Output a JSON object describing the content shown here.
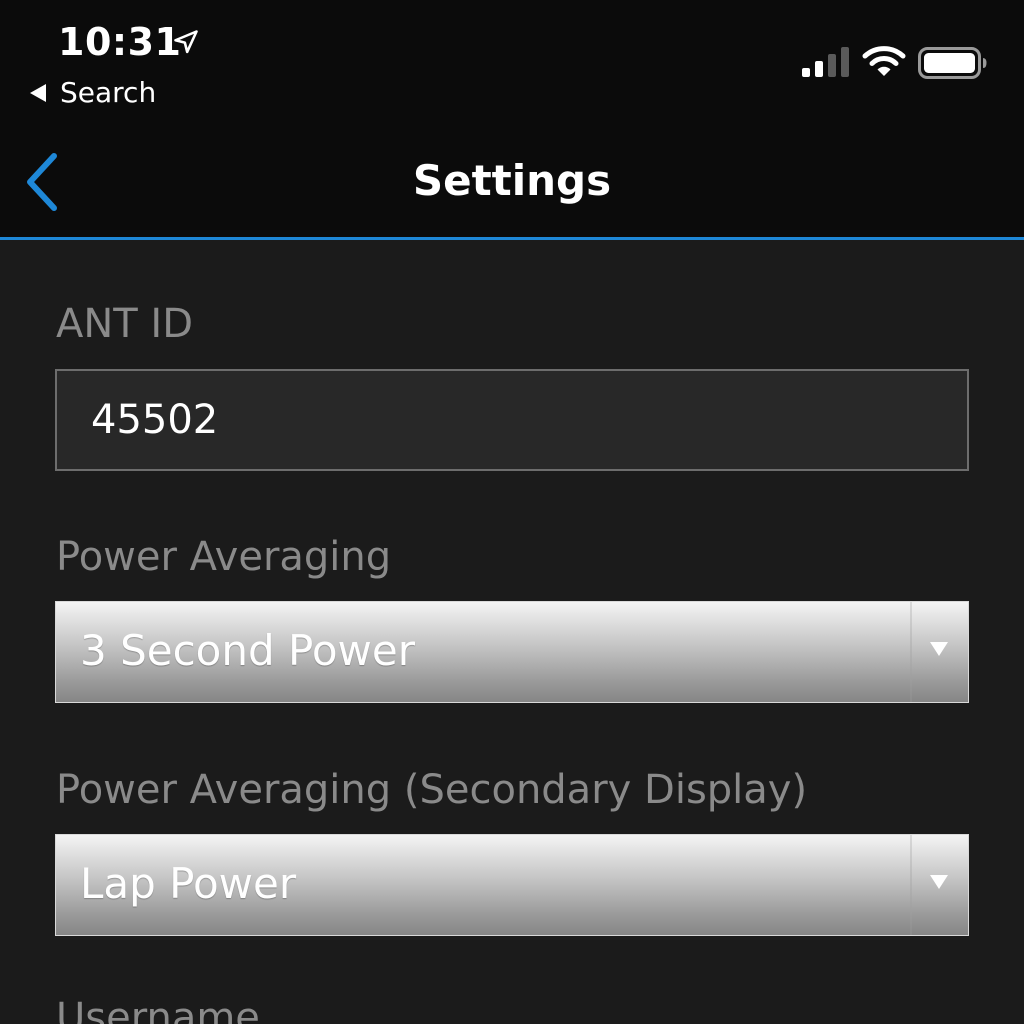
{
  "status_bar": {
    "time": "10:31",
    "back_app_label": "Search"
  },
  "nav": {
    "title": "Settings"
  },
  "form": {
    "ant_id": {
      "label": "ANT ID",
      "value": "45502"
    },
    "power_averaging": {
      "label": "Power Averaging",
      "selected": "3 Second Power"
    },
    "power_averaging_secondary": {
      "label": "Power Averaging (Secondary Display)",
      "selected": "Lap Power"
    },
    "username": {
      "label": "Username"
    }
  },
  "colors": {
    "accent": "#1e88d8",
    "background": "#1b1b1b",
    "bar_background": "#0b0b0b",
    "label_text": "#8a8a8a"
  },
  "icons": {
    "location": "location-arrow-icon",
    "signal": "cellular-signal-icon",
    "wifi": "wifi-icon",
    "battery": "battery-icon",
    "nav_back": "chevron-left-icon",
    "dropdown": "triangle-down-icon"
  }
}
